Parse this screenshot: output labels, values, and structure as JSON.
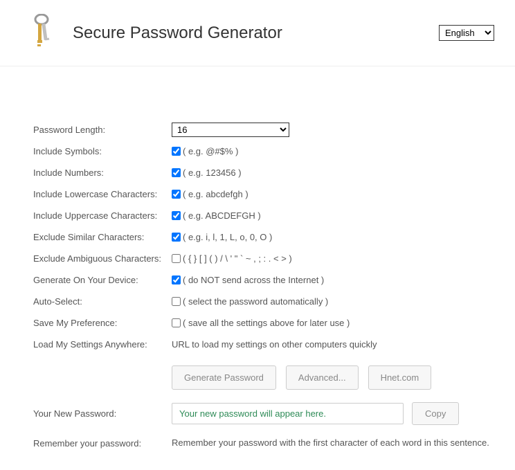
{
  "header": {
    "title": "Secure Password Generator",
    "language": "English"
  },
  "options": {
    "password_length": {
      "label": "Password Length:",
      "value": "16"
    },
    "include_symbols": {
      "label": "Include Symbols:",
      "checked": true,
      "hint": "( e.g. @#$% )"
    },
    "include_numbers": {
      "label": "Include Numbers:",
      "checked": true,
      "hint": "( e.g. 123456 )"
    },
    "include_lowercase": {
      "label": "Include Lowercase Characters:",
      "checked": true,
      "hint": "( e.g. abcdefgh )"
    },
    "include_uppercase": {
      "label": "Include Uppercase Characters:",
      "checked": true,
      "hint": "( e.g. ABCDEFGH )"
    },
    "exclude_similar": {
      "label": "Exclude Similar Characters:",
      "checked": true,
      "hint": "( e.g. i, l, 1, L, o, 0, O )"
    },
    "exclude_ambiguous": {
      "label": "Exclude Ambiguous Characters:",
      "checked": false,
      "hint": "( { } [ ] ( ) / \\ ' \" ` ~ , ; : . < > )"
    },
    "generate_on_device": {
      "label": "Generate On Your Device:",
      "checked": true,
      "hint": "( do NOT send across the Internet )"
    },
    "auto_select": {
      "label": "Auto-Select:",
      "checked": false,
      "hint": "( select the password automatically )"
    },
    "save_preference": {
      "label": "Save My Preference:",
      "checked": false,
      "hint": "( save all the settings above for later use )"
    },
    "load_settings": {
      "label": "Load My Settings Anywhere:",
      "text": "URL to load my settings on other computers quickly"
    }
  },
  "buttons": {
    "generate": "Generate Password",
    "advanced": "Advanced...",
    "hnet": "Hnet.com",
    "copy": "Copy"
  },
  "output": {
    "label": "Your New Password:",
    "placeholder": "Your new password will appear here."
  },
  "remember": {
    "label": "Remember your password:",
    "text": "Remember your password with the first character of each word in this sentence."
  }
}
